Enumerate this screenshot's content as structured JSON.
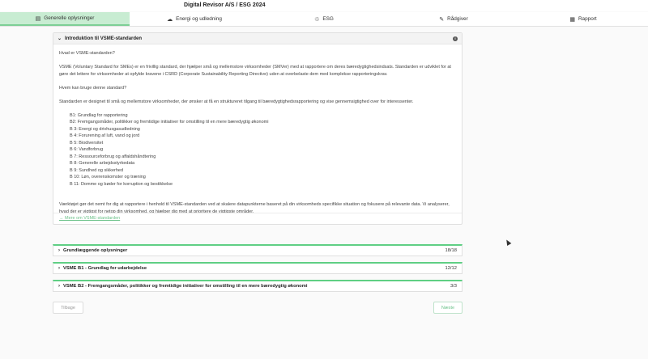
{
  "header": {
    "title": "Digital Revisor A/S / ESG 2024"
  },
  "tabs": [
    {
      "label": "Generelle oplysninger",
      "icon": "document-icon",
      "glyph": "▤"
    },
    {
      "label": "Energi og udledning",
      "icon": "cloud-icon",
      "glyph": "☁"
    },
    {
      "label": "ESG",
      "icon": "recycle-icon",
      "glyph": "♲"
    },
    {
      "label": "Rådgiver",
      "icon": "pencil-icon",
      "glyph": "✎"
    },
    {
      "label": "Rapport",
      "icon": "report-icon",
      "glyph": "▦"
    }
  ],
  "intro": {
    "title": "Introduktion til VSME-standarden",
    "q1": "Hvad er VSME-standarden?",
    "p1": "VSME (Voluntary Standard for SMEs) er en frivillig standard, der hjælper små og mellemstore virksomheder (SMVer) med at rapportere om deres bæredygtighedsindsats. Standarden er udviklet for at gøre det lettere for virksomheder at opfylde kravene i CSRD (Corporate Sustainability Reporting Directive) uden at overbelaste dem med komplekse rapporteringskrav.",
    "q2": "Hvem kan bruge denne standard?",
    "p2": "Standarden er designet til små og mellemstore virksomheder, der ønsker at få en struktureret tilgang til bæredygtighedsrapportering og vise gennemsigtighed over for interessenter.",
    "items": [
      "B1: Grundlag for rapportering",
      "B2: Fremgangsmåder, politikker og fremtidige initiativer for omstilling til en mere bæredygtig økonomi",
      "B 3: Energi og drivhusgasudledning",
      "B 4: Forurening af luft, vand og jord",
      "B 5: Biodiversitet",
      "B 6: Vandforbrug",
      "B 7: Ressourceforbrug og affaldshåndtering",
      "B 8: Generelle arbejdsstyrkedata",
      "B 9: Sundhed og sikkerhed",
      "B 10: Løn, overenskomster og træning",
      "B 11: Domme og bøder for korruption og bestikkelse"
    ],
    "p3": "Værktøjet gør det nemt for dig at rapportere i henhold til VSME-standarden ved at skalere datapunkterne baseret på din virksomheds specifikke situation og fokusere på relevante data. Vi analyserer, hvad der er vigtigst for netop din virksomhed, og hjælper dig med at prioritere de vigtigste områder.",
    "link": "→ Mere om VSME-standarden"
  },
  "sections": [
    {
      "title": "Grundlæggende oplysninger",
      "count": "18/18"
    },
    {
      "title": "VSME B1 - Grundlag for udarbejdelse",
      "count": "12/12"
    },
    {
      "title": "VSME B2 - Fremgangsmåder, politikker og fremtidige initiativer for omstilling til en mere bæredygtig økonomi",
      "count": "3/3"
    }
  ],
  "buttons": {
    "back": "Tilbage",
    "next": "Næste"
  },
  "colors": {
    "accent": "#5fcf84",
    "active_tab": "#c8ecd2"
  }
}
